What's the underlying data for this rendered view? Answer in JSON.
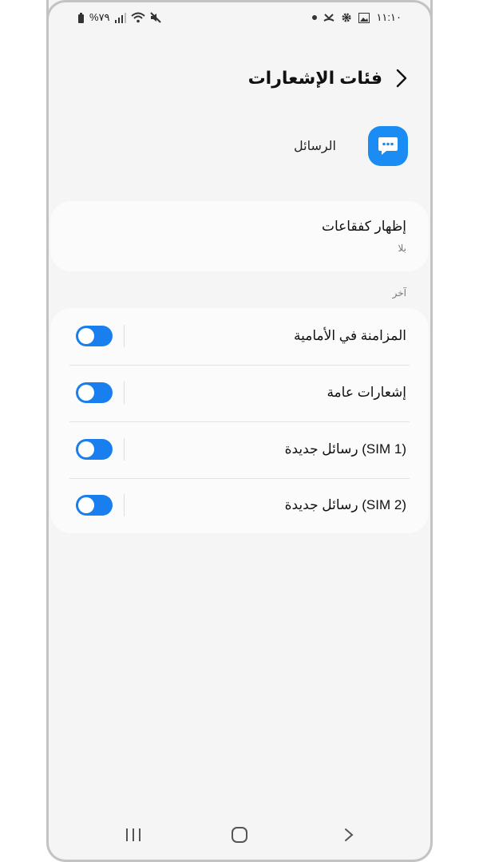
{
  "status_bar": {
    "battery": "%٧٩",
    "time": "١١:١٠",
    "left_icons": [
      "battery-icon",
      "signal-icon",
      "wifi-icon",
      "mute-icon"
    ],
    "right_icons": [
      "dot-icon",
      "missed-call-icon",
      "settings-icon",
      "gallery-icon"
    ]
  },
  "header": {
    "title": "فئات الإشعارات",
    "back_icon": "chevron-right-icon"
  },
  "app": {
    "name": "الرسائل",
    "icon": "messages-icon",
    "icon_color": "#1a8cf4"
  },
  "bubbles": {
    "title": "إظهار كفقاعات",
    "value": "بلا"
  },
  "other_section": {
    "label": "آخر",
    "items": [
      {
        "label": "المزامنة في الأمامية",
        "enabled": true
      },
      {
        "label": "إشعارات عامة",
        "enabled": true
      },
      {
        "label": "رسائل جديدة (SIM 1)",
        "enabled": true
      },
      {
        "label": "رسائل جديدة (SIM 2)",
        "enabled": true
      }
    ]
  },
  "colors": {
    "accent": "#1a7fee",
    "background": "#f5f5f5",
    "card": "#fbfbfb"
  },
  "nav_bar": [
    "recents-icon",
    "home-icon",
    "back-icon"
  ]
}
